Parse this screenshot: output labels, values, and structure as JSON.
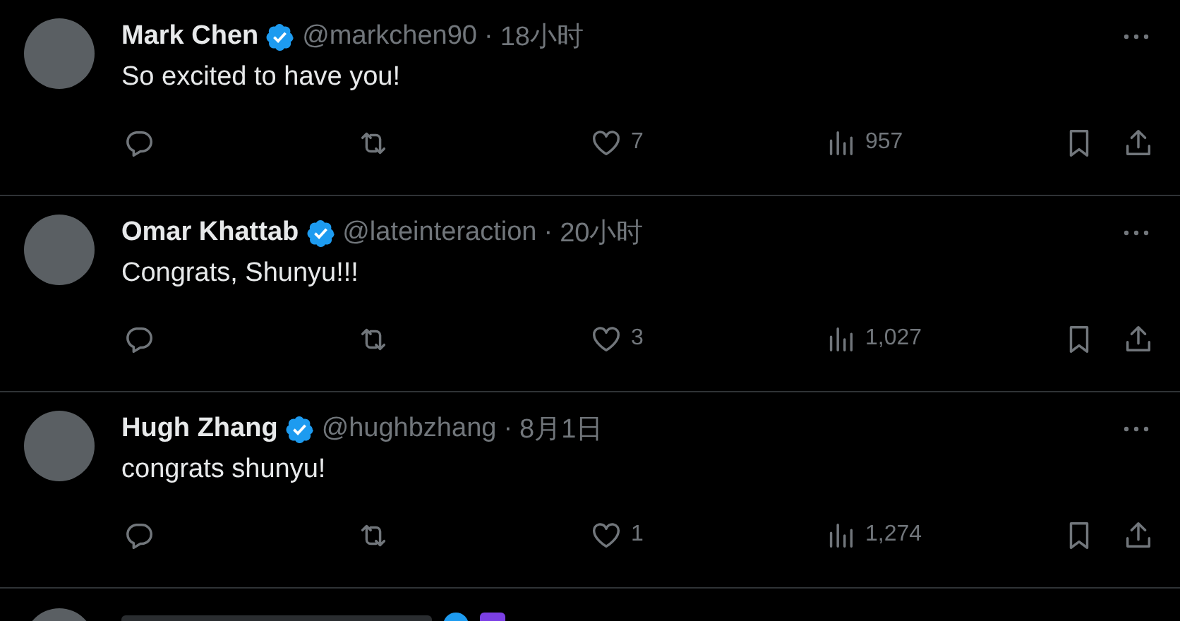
{
  "posts": [
    {
      "name": "Mark Chen",
      "verified": true,
      "handle": "@markchen90",
      "separator": "·",
      "time": "18小时",
      "text": "So excited to have you!",
      "likes": "7",
      "views": "957"
    },
    {
      "name": "Omar Khattab",
      "verified": true,
      "handle": "@lateinteraction",
      "separator": "·",
      "time": "20小时",
      "text": "Congrats, Shunyu!!!",
      "likes": "3",
      "views": "1,027"
    },
    {
      "name": "Hugh Zhang",
      "verified": true,
      "handle": "@hughbzhang",
      "separator": "·",
      "time": "8月1日",
      "text": "congrats shunyu!",
      "likes": "1",
      "views": "1,274"
    }
  ],
  "partial_post": {
    "verified": true
  }
}
